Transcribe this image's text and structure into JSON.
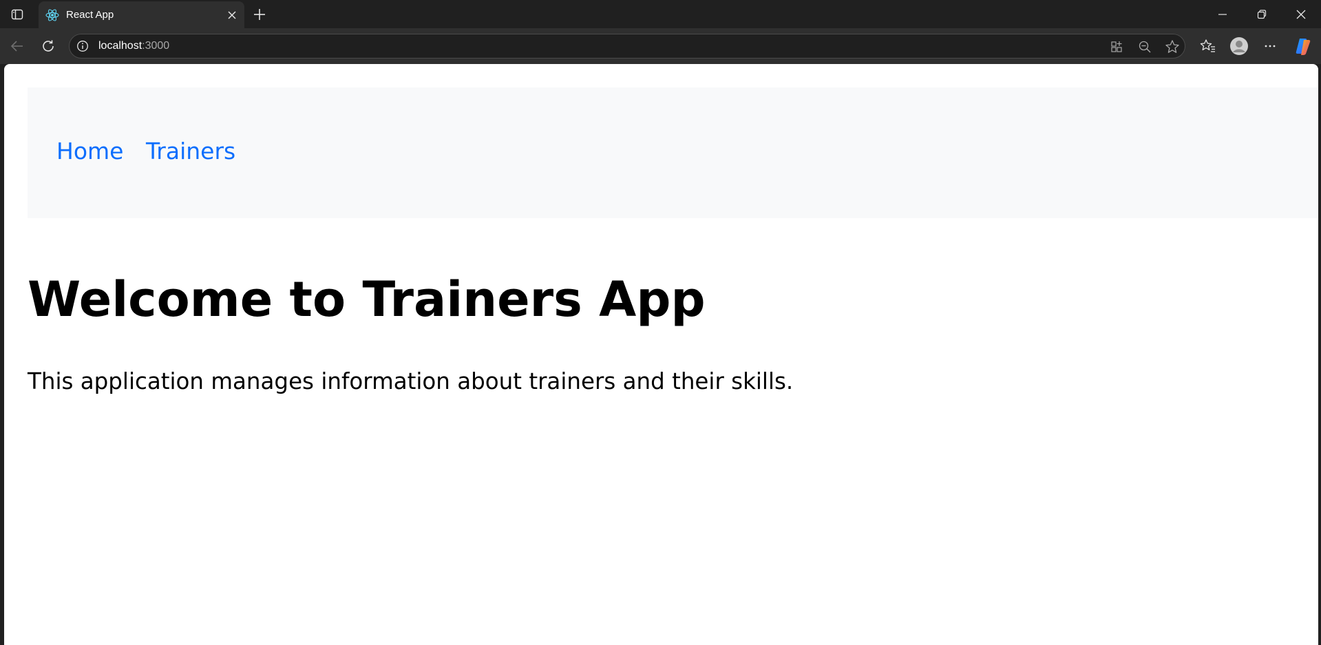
{
  "browser": {
    "tab_title": "React App",
    "url_host": "localhost",
    "url_port": ":3000",
    "icons": {
      "sidebar": "sidebar-toggle-icon",
      "favicon": "react-logo-icon",
      "tab_close": "close-icon",
      "new_tab": "plus-icon",
      "minimize": "minimize-icon",
      "restore": "restore-icon",
      "close_window": "close-icon",
      "back": "back-arrow-icon",
      "refresh": "refresh-icon",
      "site_info": "info-icon",
      "app_available": "app-available-icon",
      "zoom": "zoom-out-icon",
      "favorite": "star-icon",
      "favorites": "favorites-list-icon",
      "profile": "profile-avatar-icon",
      "more": "more-dots-icon",
      "copilot": "copilot-icon"
    },
    "colors": {
      "frame": "#202020",
      "toolbar": "#2f2f2f",
      "omnibox": "#1f1f1f"
    }
  },
  "page": {
    "nav": {
      "home_label": "Home",
      "trainers_label": "Trainers"
    },
    "heading": "Welcome to Trainers App",
    "description": "This application manages information about trainers and their skills.",
    "colors": {
      "link": "#0d6efd",
      "navbar_bg": "#f8f9fa"
    }
  }
}
